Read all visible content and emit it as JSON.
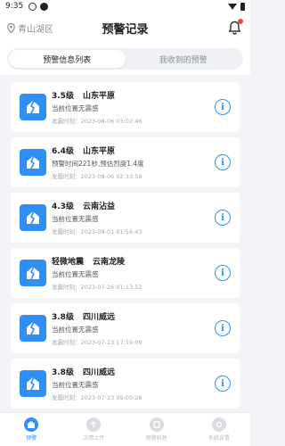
{
  "status_bar": {
    "time": "9:35"
  },
  "header": {
    "location": "青山湖区",
    "title": "预警记录"
  },
  "tabs": [
    {
      "label": "预警信息列表",
      "active": true
    },
    {
      "label": "我收到的预警",
      "active": false
    }
  ],
  "records": [
    {
      "magnitude": "3.5级",
      "place": "山东平原",
      "desc": "当前位置无震感",
      "time": "发震时刻：2023-08-06 03:02:46"
    },
    {
      "magnitude": "6.4级",
      "place": "山东平原",
      "desc": "预警时间221秒,预估烈度1.4度",
      "time": "发震时刻：2023-08-06 02:33:59"
    },
    {
      "magnitude": "4.3级",
      "place": "云南沾益",
      "desc": "当前位置无震感",
      "time": "发震时刻：2023-08-01 01:56:43"
    },
    {
      "magnitude": "轻微地震",
      "place": "云南龙陵",
      "desc": "当前位置无震感",
      "time": "发震时刻：2023-07-26 01:13:52"
    },
    {
      "magnitude": "3.8级",
      "place": "四川威远",
      "desc": "当前位置无震感",
      "time": "发震时刻：2023-07-23 17:19:09"
    },
    {
      "magnitude": "3.8级",
      "place": "四川威远",
      "desc": "当前位置无震感",
      "time": "发震时刻：2023-07-23 09:00:28"
    }
  ],
  "bottom_nav": [
    {
      "label": "预警",
      "active": true
    },
    {
      "label": "灾情上传",
      "active": false
    },
    {
      "label": "预警科普",
      "active": false
    },
    {
      "label": "系统设置",
      "active": false
    }
  ],
  "colors": {
    "accent": "#2f8ff5",
    "badge": "#e94545"
  }
}
